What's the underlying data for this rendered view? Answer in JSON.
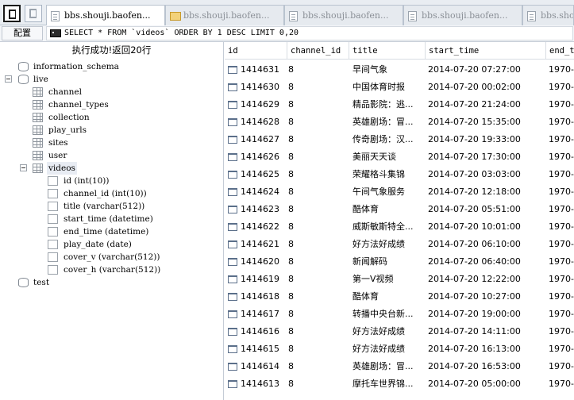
{
  "tabs": [
    {
      "label": "bbs.shouji.baofen...",
      "active": true,
      "icon": "doc"
    },
    {
      "label": "bbs.shouji.baofen...",
      "active": false,
      "icon": "folder"
    },
    {
      "label": "bbs.shouji.baofen...",
      "active": false,
      "icon": "doc"
    },
    {
      "label": "bbs.shouji.baofen...",
      "active": false,
      "icon": "doc"
    },
    {
      "label": "bbs.shouji.baofen...",
      "active": false,
      "icon": "doc"
    }
  ],
  "toolbar": {
    "config_label": "配置",
    "sql": "SELECT * FROM `videos` ORDER BY 1 DESC LIMIT 0,20"
  },
  "status_text": "执行成功!返回20行",
  "tree": {
    "databases": [
      {
        "name": "information_schema"
      },
      {
        "name": "live"
      },
      {
        "name": "test"
      }
    ],
    "tables": [
      "channel",
      "channel_types",
      "collection",
      "play_urls",
      "sites",
      "user",
      "videos"
    ],
    "columns": [
      "id (int(10))",
      "channel_id (int(10))",
      "title (varchar(512))",
      "start_time (datetime)",
      "end_time (datetime)",
      "play_date (date)",
      "cover_v (varchar(512))",
      "cover_h (varchar(512))"
    ]
  },
  "grid": {
    "headers": [
      "id",
      "channel_id",
      "title",
      "start_time",
      "end_t"
    ],
    "rows": [
      [
        "1414631",
        "8",
        "早间气象",
        "2014-07-20 07:27:00",
        "1970-0"
      ],
      [
        "1414630",
        "8",
        "中国体育时报",
        "2014-07-20 00:02:00",
        "1970-0"
      ],
      [
        "1414629",
        "8",
        "精品影院：逃...",
        "2014-07-20 21:24:00",
        "1970-0"
      ],
      [
        "1414628",
        "8",
        "英雄剧场：冒...",
        "2014-07-20 15:35:00",
        "1970-0"
      ],
      [
        "1414627",
        "8",
        "传奇剧场：汉...",
        "2014-07-20 19:33:00",
        "1970-0"
      ],
      [
        "1414626",
        "8",
        "美丽天天谈",
        "2014-07-20 17:30:00",
        "1970-0"
      ],
      [
        "1414625",
        "8",
        "荣耀格斗集锦",
        "2014-07-20 03:03:00",
        "1970-0"
      ],
      [
        "1414624",
        "8",
        "午间气象服务",
        "2014-07-20 12:18:00",
        "1970-0"
      ],
      [
        "1414623",
        "8",
        "酷体育",
        "2014-07-20 05:51:00",
        "1970-0"
      ],
      [
        "1414622",
        "8",
        "威斯敏斯特全...",
        "2014-07-20 10:01:00",
        "1970-0"
      ],
      [
        "1414621",
        "8",
        "好方法好成绩",
        "2014-07-20 06:10:00",
        "1970-0"
      ],
      [
        "1414620",
        "8",
        "新闻解码",
        "2014-07-20 06:40:00",
        "1970-0"
      ],
      [
        "1414619",
        "8",
        "第一V视频",
        "2014-07-20 12:22:00",
        "1970-0"
      ],
      [
        "1414618",
        "8",
        "酷体育",
        "2014-07-20 10:27:00",
        "1970-0"
      ],
      [
        "1414617",
        "8",
        "转播中央台新...",
        "2014-07-20 19:00:00",
        "1970-0"
      ],
      [
        "1414616",
        "8",
        "好方法好成绩",
        "2014-07-20 14:11:00",
        "1970-0"
      ],
      [
        "1414615",
        "8",
        "好方法好成绩",
        "2014-07-20 16:13:00",
        "1970-0"
      ],
      [
        "1414614",
        "8",
        "英雄剧场：冒...",
        "2014-07-20 16:53:00",
        "1970-0"
      ],
      [
        "1414613",
        "8",
        "摩托车世界锦...",
        "2014-07-20 05:00:00",
        "1970-0"
      ]
    ]
  }
}
